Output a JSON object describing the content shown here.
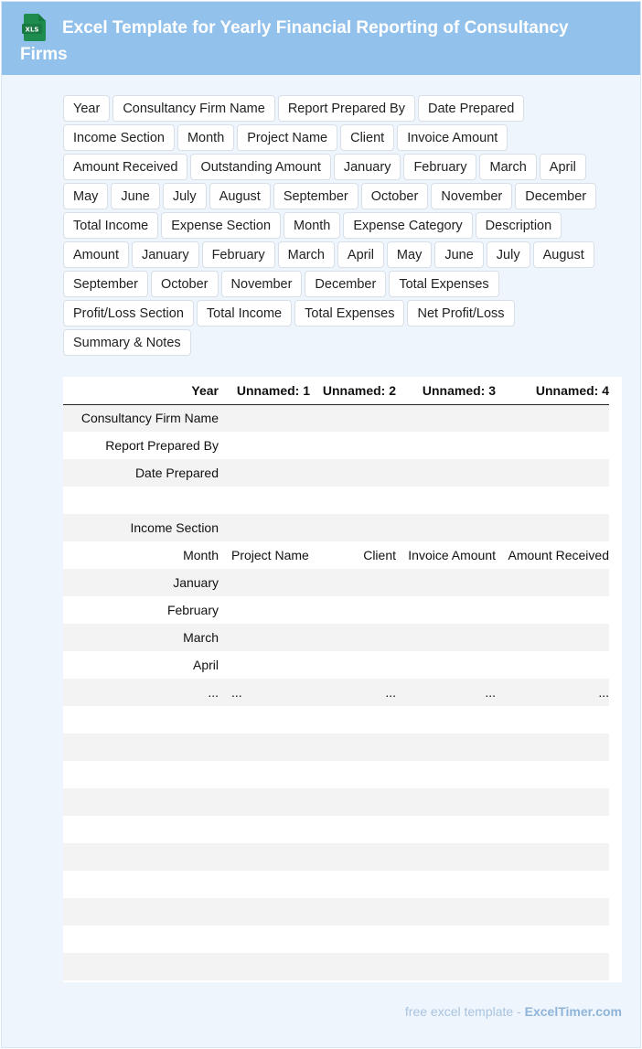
{
  "header": {
    "title": "Excel Template for Yearly Financial Reporting of Consultancy Firms",
    "icon": "xls-file-icon",
    "icon_text": "XLS",
    "accent": "#92c1eb"
  },
  "tags": [
    "Year",
    "Consultancy Firm Name",
    "Report Prepared By",
    "Date Prepared",
    "Income Section",
    "Month",
    "Project Name",
    "Client",
    "Invoice Amount",
    "Amount Received",
    "Outstanding Amount",
    "January",
    "February",
    "March",
    "April",
    "May",
    "June",
    "July",
    "August",
    "September",
    "October",
    "November",
    "December",
    "Total Income",
    "Expense Section",
    "Month",
    "Expense Category",
    "Description",
    "Amount",
    "January",
    "February",
    "March",
    "April",
    "May",
    "June",
    "July",
    "August",
    "September",
    "October",
    "November",
    "December",
    "Total Expenses",
    "Profit/Loss Section",
    "Total Income",
    "Total Expenses",
    "Net Profit/Loss",
    "Summary & Notes"
  ],
  "table": {
    "columns": [
      "Year",
      "Unnamed: 1",
      "Unnamed: 2",
      "Unnamed: 3",
      "Unnamed: 4"
    ],
    "rows": [
      {
        "idx": "0",
        "cells": [
          "Consultancy Firm Name",
          "",
          "",
          "",
          ""
        ]
      },
      {
        "idx": "1",
        "cells": [
          "Report Prepared By",
          "",
          "",
          "",
          ""
        ]
      },
      {
        "idx": "2",
        "cells": [
          "Date Prepared",
          "",
          "",
          "",
          ""
        ]
      },
      {
        "idx": "3",
        "cells": [
          "",
          "",
          "",
          "",
          ""
        ]
      },
      {
        "idx": "4",
        "cells": [
          "Income Section",
          "",
          "",
          "",
          ""
        ]
      },
      {
        "idx": "5",
        "cells": [
          "Month",
          "Project Name",
          "Client",
          "Invoice Amount",
          "Amount Received"
        ]
      },
      {
        "idx": "6",
        "cells": [
          "January",
          "",
          "",
          "",
          ""
        ]
      },
      {
        "idx": "7",
        "cells": [
          "February",
          "",
          "",
          "",
          ""
        ]
      },
      {
        "idx": "8",
        "cells": [
          "March",
          "",
          "",
          "",
          ""
        ]
      },
      {
        "idx": "9",
        "cells": [
          "April",
          "",
          "",
          "",
          ""
        ]
      },
      {
        "idx": "...",
        "cells": [
          "...",
          "...",
          "...",
          "...",
          "..."
        ]
      },
      {
        "idx": "2",
        "cells": [
          "",
          "",
          "",
          "",
          ""
        ]
      },
      {
        "idx": "3",
        "cells": [
          "",
          "",
          "",
          "",
          ""
        ]
      },
      {
        "idx": "4",
        "cells": [
          "",
          "",
          "",
          "",
          ""
        ]
      },
      {
        "idx": "5",
        "cells": [
          "",
          "",
          "",
          "",
          ""
        ]
      },
      {
        "idx": "6",
        "cells": [
          "",
          "",
          "",
          "",
          ""
        ]
      },
      {
        "idx": "7",
        "cells": [
          "",
          "",
          "",
          "",
          ""
        ]
      },
      {
        "idx": "8",
        "cells": [
          "",
          "",
          "",
          "",
          ""
        ]
      },
      {
        "idx": "9",
        "cells": [
          "",
          "",
          "",
          "",
          ""
        ]
      },
      {
        "idx": "0",
        "cells": [
          "",
          "",
          "",
          "",
          ""
        ]
      },
      {
        "idx": "1",
        "cells": [
          "",
          "",
          "",
          "",
          ""
        ]
      }
    ]
  },
  "footer": {
    "prefix": "free excel template - ",
    "brand": "ExcelTimer.com"
  }
}
